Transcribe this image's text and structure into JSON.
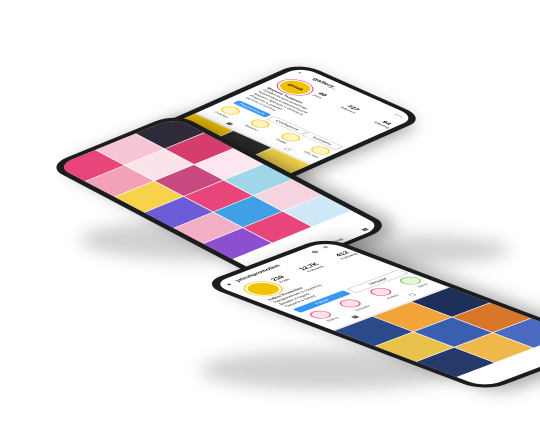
{
  "phone_right": {
    "username": "gallery_",
    "stats": [
      "40",
      "727",
      "94"
    ],
    "stat_labels": [
      "posts",
      "followers",
      "following"
    ],
    "bio_lines": [
      "Марина Тыщенко",
      "Графический дизайнер",
      "Креативные решения для",
      "вашего бренда и бизнеса",
      "Пишите в директ"
    ],
    "link": "taplink.cc/gallery",
    "logo_text": "gmak",
    "buttons": [
      "Подписаться",
      "Сообщение",
      "Контакты"
    ],
    "highlights": [
      "Отзывы",
      "Работы",
      "Прайс",
      "Обо мне"
    ]
  },
  "phone_left": {
    "username": "vkdesign.shop"
  },
  "phone_bottom": {
    "username": "yelcvkpromotion",
    "stats": [
      "219",
      "12,7K",
      "412"
    ],
    "stat_labels": [
      "Posts",
      "Followers",
      "Following"
    ],
    "bio_lines": [
      "Yellow Promotion",
      "Продвижение в соцсетях",
      "Дизайн и таргет",
      "Пишите в Direct"
    ],
    "highlights": [
      "Кейсы",
      "Отзывы",
      "Услуги",
      "Цены"
    ],
    "buttons": [
      "Follow",
      "Message"
    ]
  },
  "colors": {
    "frame": "#1b1c1e",
    "accent_yellow": "#f2c200",
    "accent_pink": "#e8457a",
    "accent_blue": "#3897f0"
  }
}
